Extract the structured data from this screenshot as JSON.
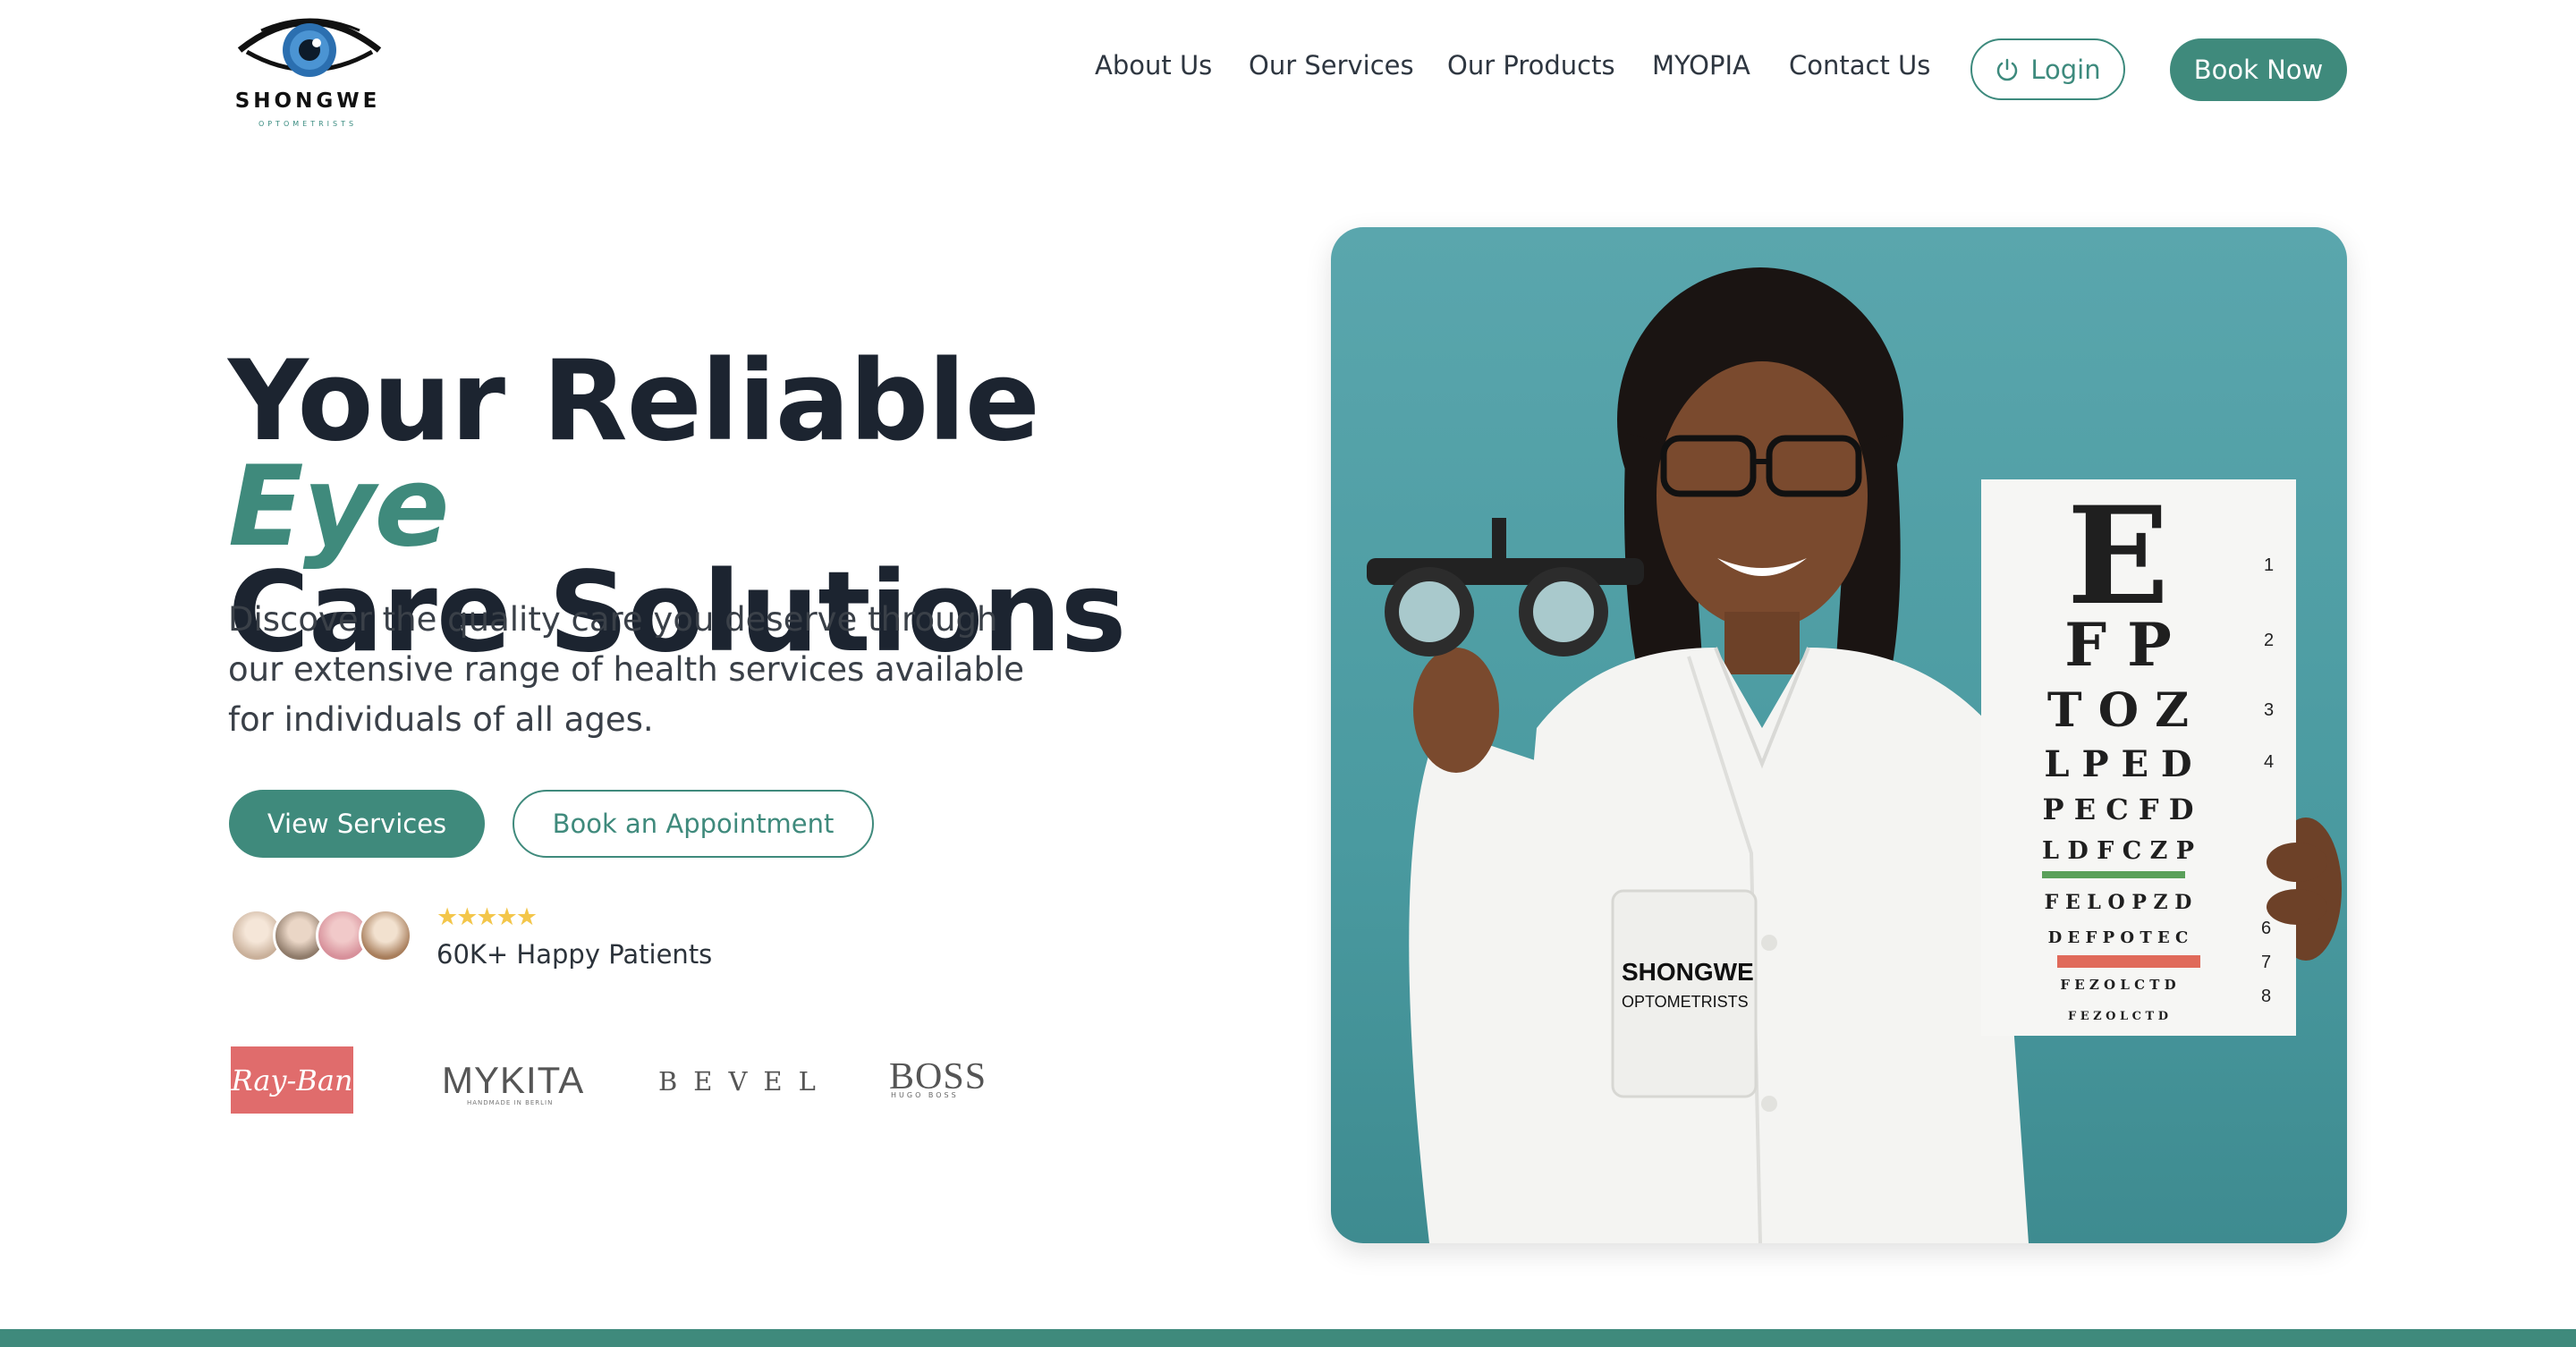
{
  "header": {
    "logo_name": "SHONGWE",
    "logo_sub": "OPTOMETRISTS",
    "nav": [
      "About Us",
      "Our Services",
      "Our Products",
      "MYOPIA",
      "Contact Us"
    ],
    "login_label": "Login",
    "book_label": "Book Now"
  },
  "hero": {
    "title_part1": "Your Reliable ",
    "title_accent": "Eye",
    "title_part2": "Care Solutions",
    "description": "Discover the quality care you deserve through our extensive range of health services available for individuals of all ages.",
    "primary_button": "View Services",
    "secondary_button": "Book an Appointment",
    "stars": "★★★★★",
    "rating": 5,
    "patients_label": "60K+ Happy Patients"
  },
  "brands": {
    "rayban": "Ray-Ban",
    "mykita": "MYKITA",
    "mykita_sub": "HANDMADE IN BERLIN",
    "bevel": "BEVEL",
    "boss": "BOSS",
    "boss_sub": "HUGO BOSS"
  },
  "image": {
    "coat_name": "SHONGWE",
    "coat_sub": "OPTOMETRISTS",
    "chart_rows": [
      "E",
      "F P",
      "T O Z",
      "L P E D",
      "P E C F D",
      "L D F C Z P",
      "F E L O P Z D",
      "D E F P O T E C",
      "F E Z O L C T D",
      "F E Z O L C T D"
    ],
    "chart_numbers": [
      "1",
      "2",
      "3",
      "4",
      "6",
      "7",
      "8"
    ]
  },
  "colors": {
    "accent": "#3f8a7c",
    "heading": "#1c2430",
    "image_bg": "#4f9ea4"
  },
  "icons": {
    "login": "power-icon",
    "logo": "eye-icon"
  }
}
